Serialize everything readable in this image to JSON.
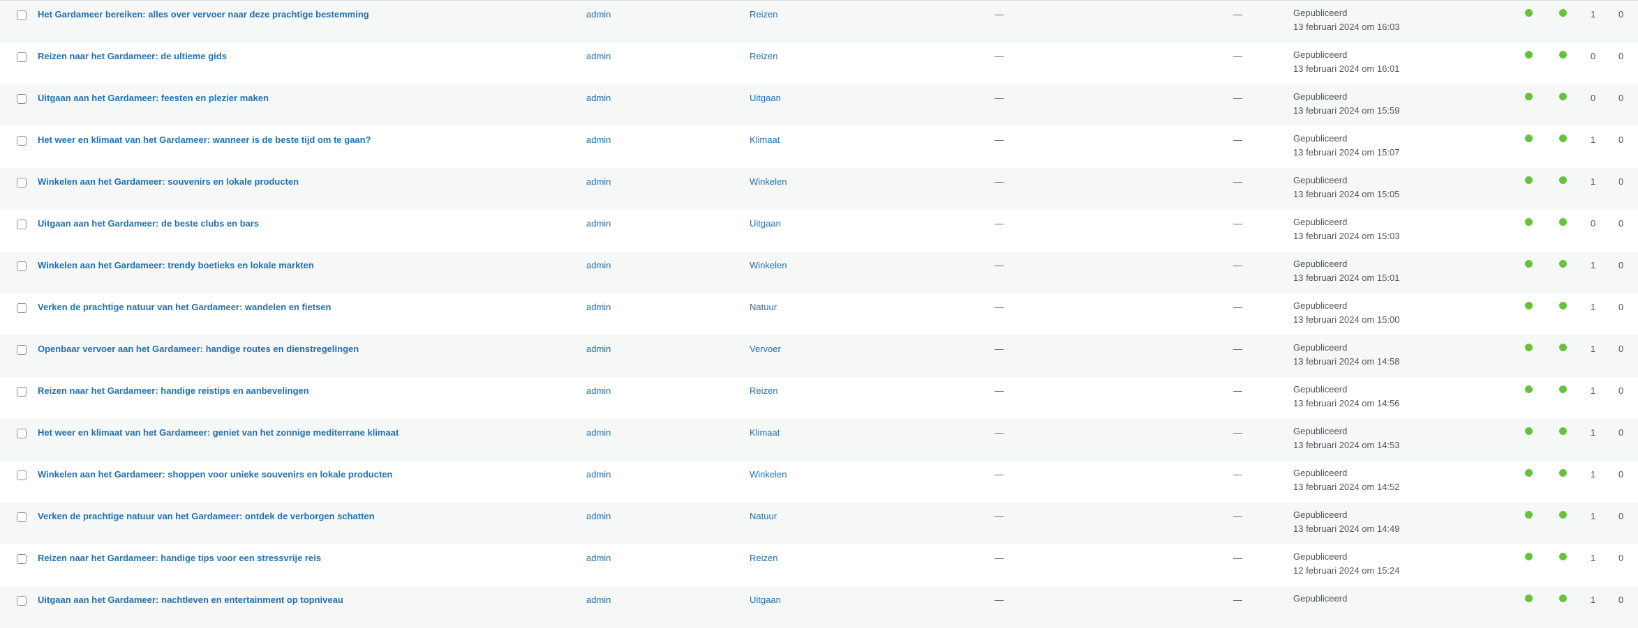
{
  "colors": {
    "link": "#2271b1",
    "status_dot": "#65c339",
    "row_alt": "#f6f7f7"
  },
  "rows": [
    {
      "title": "Het Gardameer bereiken: alles over vervoer naar deze prachtige bestemming",
      "author": "admin",
      "category": "Reizen",
      "tags": "—",
      "comments": "—",
      "status": "Gepubliceerd",
      "date": "13 februari 2024 om 16:03",
      "count1": "1",
      "count2": "0"
    },
    {
      "title": "Reizen naar het Gardameer: de ultieme gids",
      "author": "admin",
      "category": "Reizen",
      "tags": "—",
      "comments": "—",
      "status": "Gepubliceerd",
      "date": "13 februari 2024 om 16:01",
      "count1": "0",
      "count2": "0"
    },
    {
      "title": "Uitgaan aan het Gardameer: feesten en plezier maken",
      "author": "admin",
      "category": "Uitgaan",
      "tags": "—",
      "comments": "—",
      "status": "Gepubliceerd",
      "date": "13 februari 2024 om 15:59",
      "count1": "0",
      "count2": "0"
    },
    {
      "title": "Het weer en klimaat van het Gardameer: wanneer is de beste tijd om te gaan?",
      "author": "admin",
      "category": "Klimaat",
      "tags": "—",
      "comments": "—",
      "status": "Gepubliceerd",
      "date": "13 februari 2024 om 15:07",
      "count1": "1",
      "count2": "0"
    },
    {
      "title": "Winkelen aan het Gardameer: souvenirs en lokale producten",
      "author": "admin",
      "category": "Winkelen",
      "tags": "—",
      "comments": "—",
      "status": "Gepubliceerd",
      "date": "13 februari 2024 om 15:05",
      "count1": "1",
      "count2": "0"
    },
    {
      "title": "Uitgaan aan het Gardameer: de beste clubs en bars",
      "author": "admin",
      "category": "Uitgaan",
      "tags": "—",
      "comments": "—",
      "status": "Gepubliceerd",
      "date": "13 februari 2024 om 15:03",
      "count1": "0",
      "count2": "0"
    },
    {
      "title": "Winkelen aan het Gardameer: trendy boetieks en lokale markten",
      "author": "admin",
      "category": "Winkelen",
      "tags": "—",
      "comments": "—",
      "status": "Gepubliceerd",
      "date": "13 februari 2024 om 15:01",
      "count1": "1",
      "count2": "0"
    },
    {
      "title": "Verken de prachtige natuur van het Gardameer: wandelen en fietsen",
      "author": "admin",
      "category": "Natuur",
      "tags": "—",
      "comments": "—",
      "status": "Gepubliceerd",
      "date": "13 februari 2024 om 15:00",
      "count1": "1",
      "count2": "0"
    },
    {
      "title": "Openbaar vervoer aan het Gardameer: handige routes en dienstregelingen",
      "author": "admin",
      "category": "Vervoer",
      "tags": "—",
      "comments": "—",
      "status": "Gepubliceerd",
      "date": "13 februari 2024 om 14:58",
      "count1": "1",
      "count2": "0"
    },
    {
      "title": "Reizen naar het Gardameer: handige reistips en aanbevelingen",
      "author": "admin",
      "category": "Reizen",
      "tags": "—",
      "comments": "—",
      "status": "Gepubliceerd",
      "date": "13 februari 2024 om 14:56",
      "count1": "1",
      "count2": "0"
    },
    {
      "title": "Het weer en klimaat van het Gardameer: geniet van het zonnige mediterrane klimaat",
      "author": "admin",
      "category": "Klimaat",
      "tags": "—",
      "comments": "—",
      "status": "Gepubliceerd",
      "date": "13 februari 2024 om 14:53",
      "count1": "1",
      "count2": "0"
    },
    {
      "title": "Winkelen aan het Gardameer: shoppen voor unieke souvenirs en lokale producten",
      "author": "admin",
      "category": "Winkelen",
      "tags": "—",
      "comments": "—",
      "status": "Gepubliceerd",
      "date": "13 februari 2024 om 14:52",
      "count1": "1",
      "count2": "0"
    },
    {
      "title": "Verken de prachtige natuur van het Gardameer: ontdek de verborgen schatten",
      "author": "admin",
      "category": "Natuur",
      "tags": "—",
      "comments": "—",
      "status": "Gepubliceerd",
      "date": "13 februari 2024 om 14:49",
      "count1": "1",
      "count2": "0"
    },
    {
      "title": "Reizen naar het Gardameer: handige tips voor een stressvrije reis",
      "author": "admin",
      "category": "Reizen",
      "tags": "—",
      "comments": "—",
      "status": "Gepubliceerd",
      "date": "12 februari 2024 om 15:24",
      "count1": "1",
      "count2": "0"
    },
    {
      "title": "Uitgaan aan het Gardameer: nachtleven en entertainment op topniveau",
      "author": "admin",
      "category": "Uitgaan",
      "tags": "—",
      "comments": "—",
      "status": "Gepubliceerd",
      "date": "",
      "count1": "1",
      "count2": "0"
    }
  ]
}
